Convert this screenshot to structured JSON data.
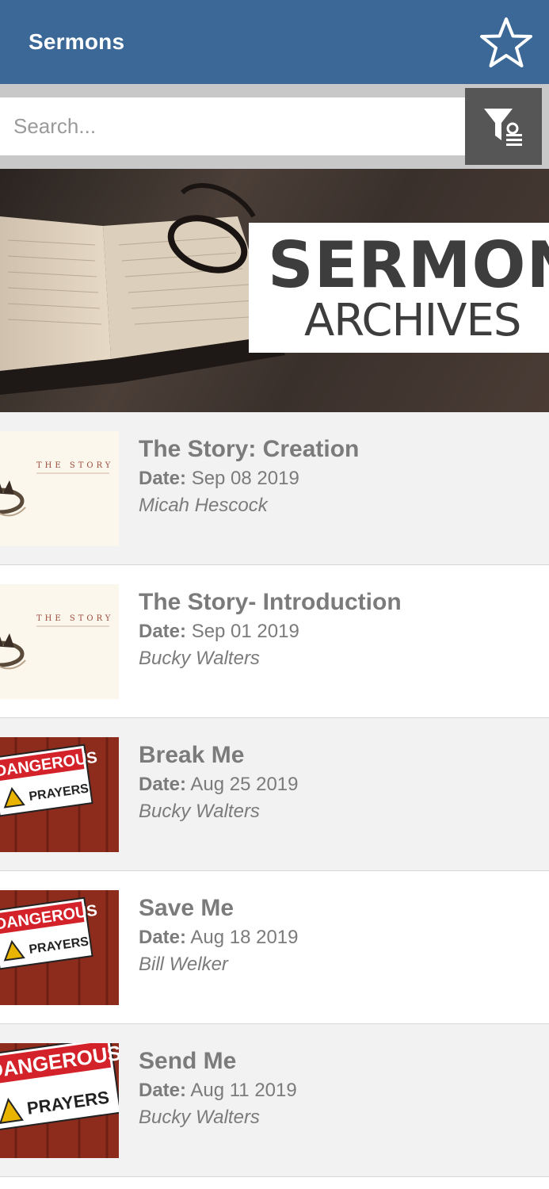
{
  "header": {
    "title": "Sermons",
    "favorite_icon": "star-outline-icon"
  },
  "search": {
    "placeholder": "Search...",
    "value": "",
    "filter_icon": "filter-list-icon"
  },
  "banner": {
    "line1": "SERMON",
    "line2": "ARCHIVES"
  },
  "colors": {
    "appbar": "#3b6896",
    "text_gray": "#7b7b7b",
    "filter_button": "#565656"
  },
  "sermons": [
    {
      "title": "The Story: Creation",
      "date_label": "Date:",
      "date": "Sep 08 2019",
      "speaker": "Micah Hescock",
      "thumb": "the-story-crown"
    },
    {
      "title": "The Story- Introduction",
      "date_label": "Date:",
      "date": "Sep 01 2019",
      "speaker": "Bucky Walters",
      "thumb": "the-story-crown"
    },
    {
      "title": "Break Me",
      "date_label": "Date:",
      "date": "Aug 25 2019",
      "speaker": "Bucky Walters",
      "thumb": "dangerous-prayers"
    },
    {
      "title": "Save Me",
      "date_label": "Date:",
      "date": "Aug 18 2019",
      "speaker": "Bill Welker",
      "thumb": "dangerous-prayers"
    },
    {
      "title": "Send Me",
      "date_label": "Date:",
      "date": "Aug 11 2019",
      "speaker": "Bucky Walters",
      "thumb": "dangerous-prayers"
    }
  ],
  "thumb_text": {
    "story_word": "THE STORY",
    "danger_word": "DANGEROUS",
    "prayers_word": "PRAYERS"
  }
}
